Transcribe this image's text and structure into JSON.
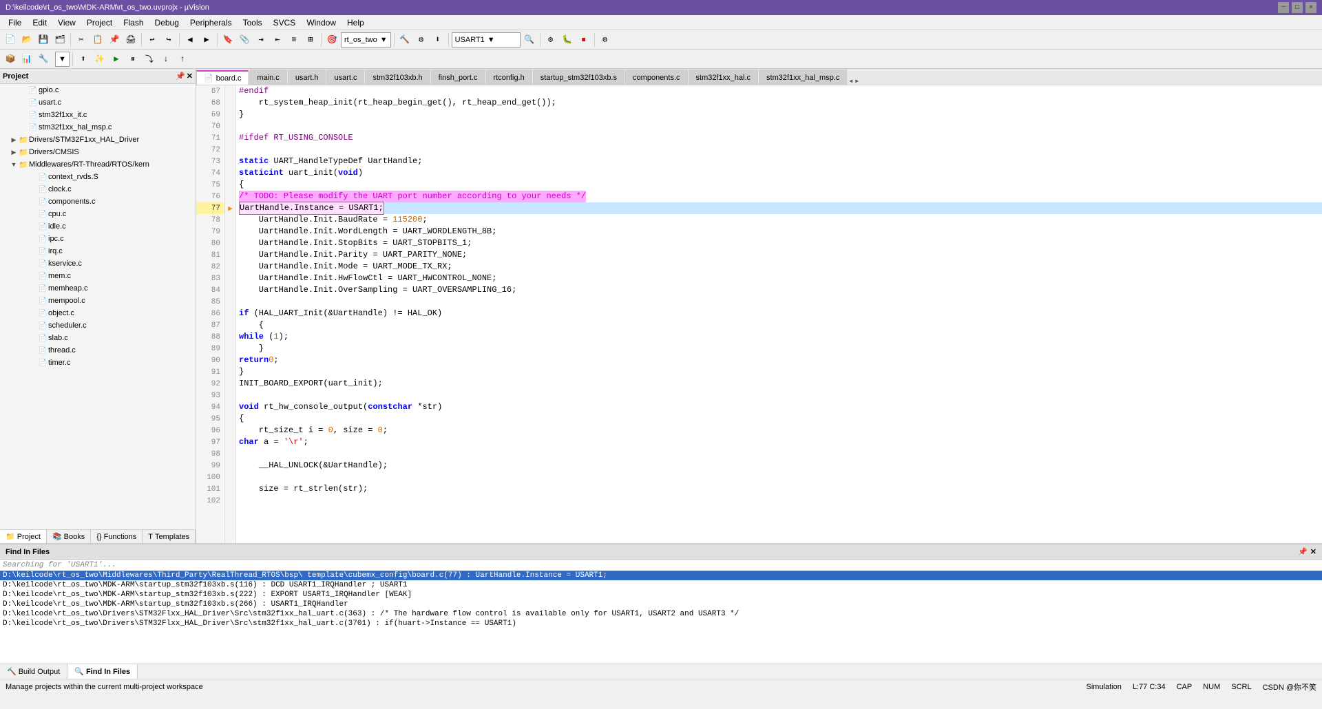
{
  "titlebar": {
    "title": "D:\\keilcode\\rt_os_two\\MDK-ARM\\rt_os_two.uvprojx - µVision",
    "controls": [
      "−",
      "□",
      "×"
    ]
  },
  "menubar": {
    "items": [
      "File",
      "Edit",
      "View",
      "Project",
      "Flash",
      "Debug",
      "Peripherals",
      "Tools",
      "SVCS",
      "Window",
      "Help"
    ]
  },
  "toolbar": {
    "target_dropdown": "rt_os_two",
    "usart1_dropdown": "USART1"
  },
  "project_panel": {
    "title": "Project",
    "items": [
      {
        "label": "gpio.c",
        "indent": 2,
        "type": "file"
      },
      {
        "label": "usart.c",
        "indent": 2,
        "type": "file"
      },
      {
        "label": "stm32f1xx_it.c",
        "indent": 2,
        "type": "file"
      },
      {
        "label": "stm32f1xx_hal_msp.c",
        "indent": 2,
        "type": "file"
      },
      {
        "label": "Drivers/STM32F1xx_HAL_Driver",
        "indent": 1,
        "type": "folder"
      },
      {
        "label": "Drivers/CMSIS",
        "indent": 1,
        "type": "folder"
      },
      {
        "label": "Middlewares/RT-Thread/RTOS/kern",
        "indent": 1,
        "type": "folder",
        "expanded": true
      },
      {
        "label": "context_rvds.S",
        "indent": 3,
        "type": "file"
      },
      {
        "label": "clock.c",
        "indent": 3,
        "type": "file"
      },
      {
        "label": "components.c",
        "indent": 3,
        "type": "file"
      },
      {
        "label": "cpu.c",
        "indent": 3,
        "type": "file"
      },
      {
        "label": "idle.c",
        "indent": 3,
        "type": "file"
      },
      {
        "label": "ipc.c",
        "indent": 3,
        "type": "file"
      },
      {
        "label": "irq.c",
        "indent": 3,
        "type": "file"
      },
      {
        "label": "kservice.c",
        "indent": 3,
        "type": "file"
      },
      {
        "label": "mem.c",
        "indent": 3,
        "type": "file"
      },
      {
        "label": "memheap.c",
        "indent": 3,
        "type": "file"
      },
      {
        "label": "mempool.c",
        "indent": 3,
        "type": "file"
      },
      {
        "label": "object.c",
        "indent": 3,
        "type": "file"
      },
      {
        "label": "scheduler.c",
        "indent": 3,
        "type": "file"
      },
      {
        "label": "slab.c",
        "indent": 3,
        "type": "file"
      },
      {
        "label": "thread.c",
        "indent": 3,
        "type": "file"
      },
      {
        "label": "timer.c",
        "indent": 3,
        "type": "file"
      }
    ]
  },
  "bottom_tabs": [
    {
      "label": "Project",
      "icon": "📁",
      "active": true
    },
    {
      "label": "Books",
      "icon": "📚",
      "active": false
    },
    {
      "label": "Functions",
      "icon": "{}",
      "active": false
    },
    {
      "label": "Templates",
      "icon": "T",
      "active": false
    }
  ],
  "file_tabs": [
    {
      "label": "board.c",
      "active": true
    },
    {
      "label": "main.c",
      "active": false
    },
    {
      "label": "usart.h",
      "active": false
    },
    {
      "label": "usart.c",
      "active": false
    },
    {
      "label": "stm32f103xb.h",
      "active": false
    },
    {
      "label": "finsh_port.c",
      "active": false
    },
    {
      "label": "rtconfig.h",
      "active": false
    },
    {
      "label": "startup_stm32f103xb.s",
      "active": false
    },
    {
      "label": "components.c",
      "active": false
    },
    {
      "label": "stm32f1xx_hal.c",
      "active": false
    },
    {
      "label": "stm32f1xx_hal_msp.c",
      "active": false
    }
  ],
  "code": {
    "lines": [
      {
        "num": 67,
        "content": "#endif"
      },
      {
        "num": 68,
        "content": "    rt_system_heap_init(rt_heap_begin_get(), rt_heap_end_get());"
      },
      {
        "num": 69,
        "content": "}"
      },
      {
        "num": 70,
        "content": ""
      },
      {
        "num": 71,
        "content": "#ifdef RT_USING_CONSOLE"
      },
      {
        "num": 72,
        "content": ""
      },
      {
        "num": 73,
        "content": "static UART_HandleTypeDef UartHandle;"
      },
      {
        "num": 74,
        "content": "static int uart_init(void)"
      },
      {
        "num": 75,
        "content": "{"
      },
      {
        "num": 76,
        "content": "    /* TODO: Please modify the UART port number according to your needs */"
      },
      {
        "num": 77,
        "content": "    UartHandle.Instance = USART1;",
        "highlight": true
      },
      {
        "num": 78,
        "content": "    UartHandle.Init.BaudRate = 115200;"
      },
      {
        "num": 79,
        "content": "    UartHandle.Init.WordLength = UART_WORDLENGTH_8B;"
      },
      {
        "num": 80,
        "content": "    UartHandle.Init.StopBits = UART_STOPBITS_1;"
      },
      {
        "num": 81,
        "content": "    UartHandle.Init.Parity = UART_PARITY_NONE;"
      },
      {
        "num": 82,
        "content": "    UartHandle.Init.Mode = UART_MODE_TX_RX;"
      },
      {
        "num": 83,
        "content": "    UartHandle.Init.HwFlowCtl = UART_HWCONTROL_NONE;"
      },
      {
        "num": 84,
        "content": "    UartHandle.Init.OverSampling = UART_OVERSAMPLING_16;"
      },
      {
        "num": 85,
        "content": ""
      },
      {
        "num": 86,
        "content": "    if (HAL_UART_Init(&UartHandle) != HAL_OK)"
      },
      {
        "num": 87,
        "content": "    {"
      },
      {
        "num": 88,
        "content": "        while (1);"
      },
      {
        "num": 89,
        "content": "    }"
      },
      {
        "num": 90,
        "content": "    return 0;"
      },
      {
        "num": 91,
        "content": "}"
      },
      {
        "num": 92,
        "content": "INIT_BOARD_EXPORT(uart_init);"
      },
      {
        "num": 93,
        "content": ""
      },
      {
        "num": 94,
        "content": "void rt_hw_console_output(const char *str)"
      },
      {
        "num": 95,
        "content": "{"
      },
      {
        "num": 96,
        "content": "    rt_size_t i = 0, size = 0;"
      },
      {
        "num": 97,
        "content": "    char a = '\\r';"
      },
      {
        "num": 98,
        "content": ""
      },
      {
        "num": 99,
        "content": "    __HAL_UNLOCK(&UartHandle);"
      },
      {
        "num": 100,
        "content": ""
      },
      {
        "num": 101,
        "content": "    size = rt_strlen(str);"
      },
      {
        "num": 102,
        "content": ""
      }
    ],
    "current_line": 77
  },
  "find_panel": {
    "title": "Find In Files",
    "search_label": "Searching for 'USART1'...",
    "results": [
      {
        "text": "D:\\keilcode\\rt_os_two\\Middlewares\\Third_Party\\RealThread_RTOS\\bsp\\ template\\cubemx_config\\board.c(77) :    UartHandle.Instance = USART1;",
        "selected": true
      },
      {
        "text": "D:\\keilcode\\rt_os_two\\MDK-ARM\\startup_stm32f103xb.s(116) :          DCD      USART1_IRQHandler     ; USART1"
      },
      {
        "text": "D:\\keilcode\\rt_os_two\\MDK-ARM\\startup_stm32f103xb.s(222) :          EXPORT   USART1_IRQHandler     [WEAK]"
      },
      {
        "text": "D:\\keilcode\\rt_os_two\\MDK-ARM\\startup_stm32f103xb.s(266) :  USART1_IRQHandler"
      },
      {
        "text": "D:\\keilcode\\rt_os_two\\Drivers\\STM32Flxx_HAL_Driver\\Src\\stm32f1xx_hal_uart.c(363) :   /* The hardware flow control is available only for USART1, USART2 and USART3 */"
      },
      {
        "text": "D:\\keilcode\\rt_os_two\\Drivers\\STM32Flxx_HAL_Driver\\Src\\stm32f1xx_hal_uart.c(3701) :   if(huart->Instance == USART1)"
      }
    ]
  },
  "output_tabs": [
    {
      "label": "Build Output",
      "icon": "🔨",
      "active": false
    },
    {
      "label": "Find In Files",
      "icon": "🔍",
      "active": true
    }
  ],
  "statusbar": {
    "message": "Manage projects within the current multi-project workspace",
    "mode": "Simulation",
    "position": "L:77 C:34",
    "caps": "CAP",
    "num": "NUM",
    "scrl": "SCRL",
    "extra": "不笑"
  }
}
